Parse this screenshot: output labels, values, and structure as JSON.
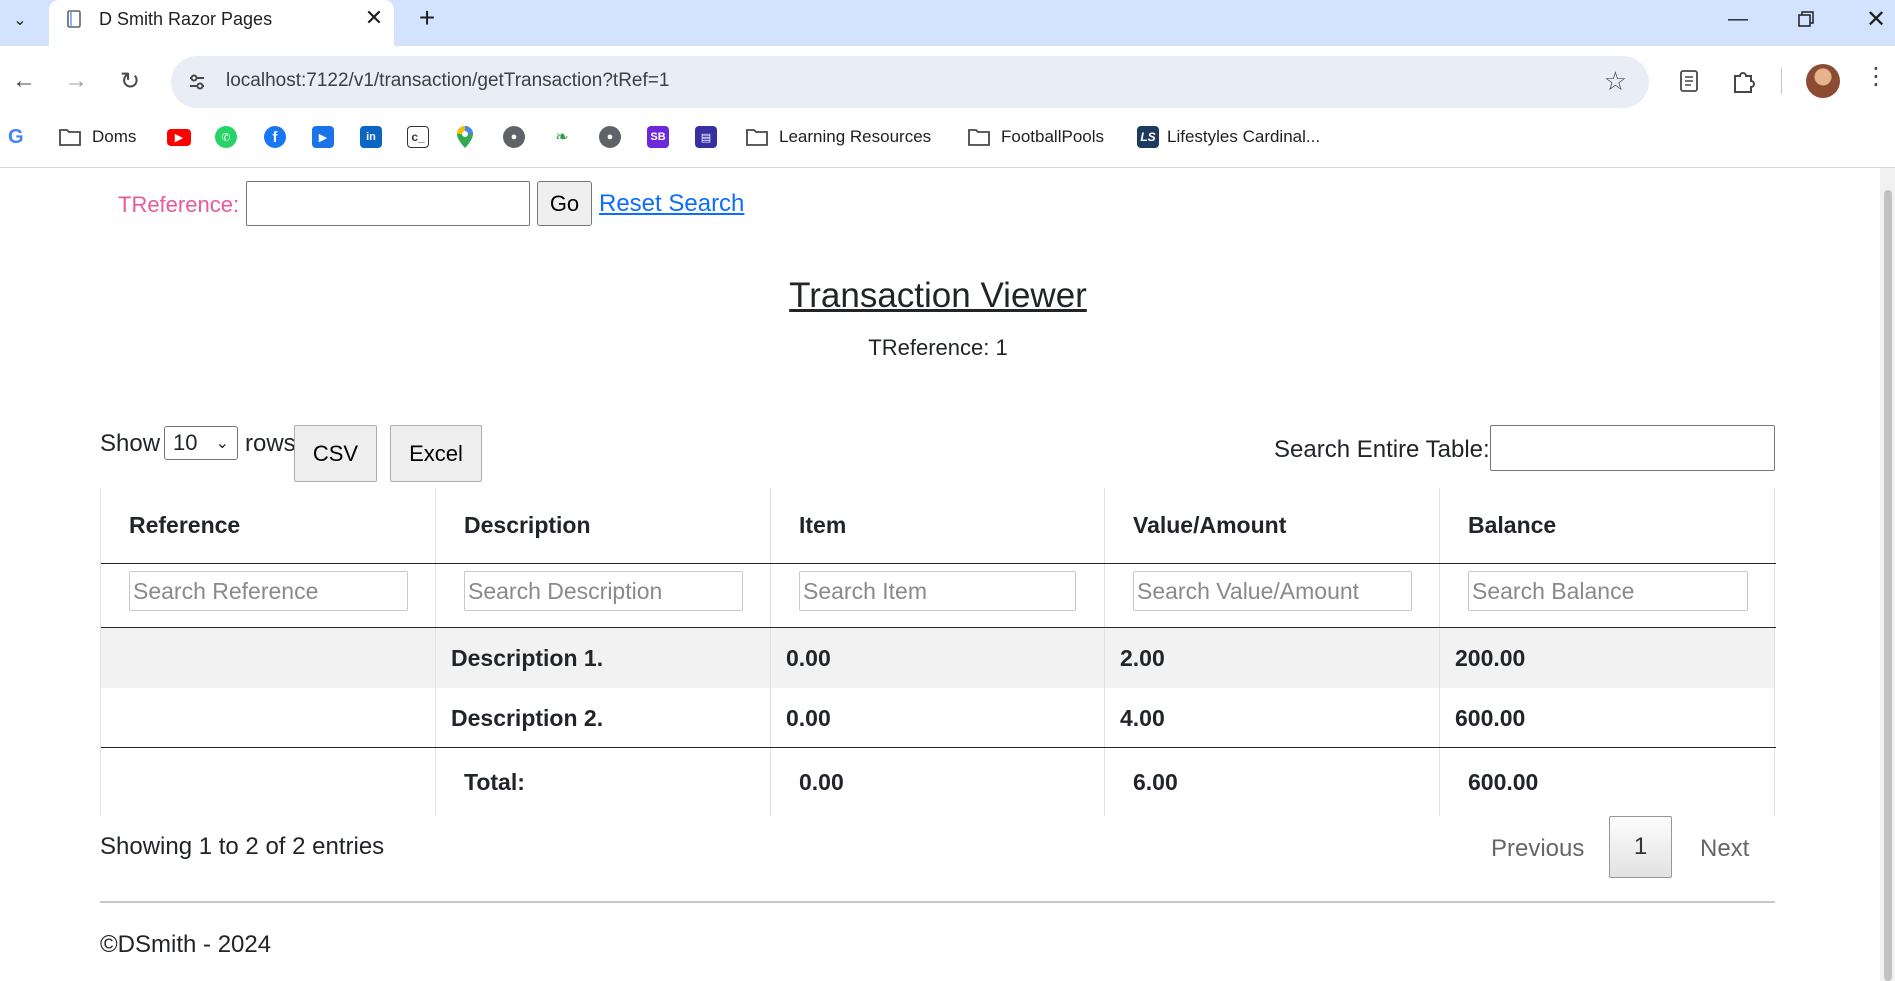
{
  "browser": {
    "tab_title": "D Smith Razor Pages",
    "url": "localhost:7122/v1/transaction/getTransaction?tRef=1",
    "bookmarks": [
      {
        "label": "Doms",
        "icon": "folder-icon"
      },
      {
        "label": "",
        "icon": "youtube-icon",
        "color": "#ff0000"
      },
      {
        "label": "",
        "icon": "whatsapp-icon",
        "color": "#25d366"
      },
      {
        "label": "",
        "icon": "facebook-icon",
        "color": "#1877f2"
      },
      {
        "label": "",
        "icon": "play-icon",
        "color": "#1a73e8"
      },
      {
        "label": "",
        "icon": "linkedin-icon",
        "color": "#0a66c2"
      },
      {
        "label": "",
        "icon": "codecademy-icon",
        "color": "#333333"
      },
      {
        "label": "",
        "icon": "maps-pin-icon",
        "color": "#34a853"
      },
      {
        "label": "",
        "icon": "globe-icon",
        "color": "#5f6368"
      },
      {
        "label": "",
        "icon": "leaf-icon",
        "color": "#2e9e44"
      },
      {
        "label": "",
        "icon": "globe-icon",
        "color": "#5f6368"
      },
      {
        "label": "",
        "icon": "sb-icon",
        "color": "#6d28d9"
      },
      {
        "label": "",
        "icon": "chart-icon",
        "color": "#3730a3"
      },
      {
        "label": "Learning Resources",
        "icon": "folder-icon"
      },
      {
        "label": "FootballPools",
        "icon": "folder-icon"
      },
      {
        "label": "Lifestyles Cardinal...",
        "icon": "ls-icon",
        "color": "#1e3a5f"
      }
    ]
  },
  "search_bar": {
    "label": "TReference:",
    "go_label": "Go",
    "reset_label": "Reset Search"
  },
  "header": {
    "title": "Transaction Viewer",
    "subtitle": "TReference: 1"
  },
  "controls": {
    "show_label": "Show",
    "rows_label": "rows",
    "page_length": "10",
    "csv_label": "CSV",
    "excel_label": "Excel",
    "search_label": "Search Entire Table:"
  },
  "table": {
    "columns": [
      "Reference",
      "Description",
      "Item",
      "Value/Amount",
      "Balance"
    ],
    "filter_placeholders": [
      "Search Reference",
      "Search Description",
      "Search Item",
      "Search Value/Amount",
      "Search Balance"
    ],
    "rows": [
      {
        "reference": "",
        "description": "Description 1.",
        "item": "0.00",
        "value": "2.00",
        "balance": "200.00"
      },
      {
        "reference": "",
        "description": "Description 2.",
        "item": "0.00",
        "value": "4.00",
        "balance": "600.00"
      }
    ],
    "footer": {
      "reference": "",
      "description": "Total:",
      "item": "0.00",
      "value": "6.00",
      "balance": "600.00"
    },
    "striped_color": "#f2f2f2"
  },
  "pagination": {
    "info": "Showing 1 to 2 of 2 entries",
    "previous": "Previous",
    "current": "1",
    "next": "Next"
  },
  "footer": {
    "text": "©DSmith - 2024"
  },
  "colors": {
    "tref_label": "#e75a9b",
    "link": "#0d6efd",
    "chrome_bg": "#d3e3fd"
  }
}
